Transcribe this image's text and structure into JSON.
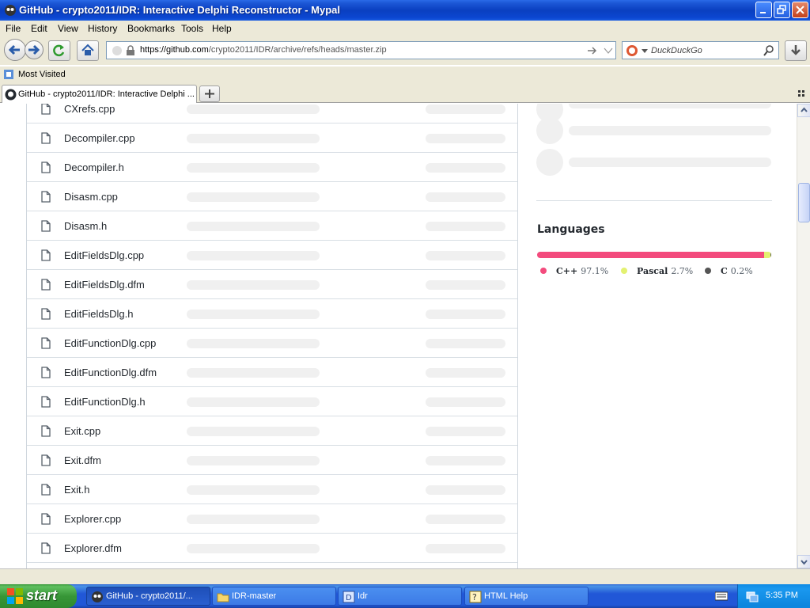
{
  "window": {
    "title": "GitHub - crypto2011/IDR: Interactive Delphi Reconstructor - Mypal"
  },
  "menu": [
    "File",
    "Edit",
    "View",
    "History",
    "Bookmarks",
    "Tools",
    "Help"
  ],
  "address": {
    "url_host": "https://github.com",
    "url_path": "/crypto2011/IDR/archive/refs/heads/master.zip"
  },
  "search": {
    "placeholder": "DuckDuckGo"
  },
  "bookmarks": {
    "most_visited": "Most Visited"
  },
  "tab": {
    "title": "GitHub - crypto2011/IDR: Interactive Delphi ..."
  },
  "files": [
    "CXrefs.cpp",
    "Decompiler.cpp",
    "Decompiler.h",
    "Disasm.cpp",
    "Disasm.h",
    "EditFieldsDlg.cpp",
    "EditFieldsDlg.dfm",
    "EditFieldsDlg.h",
    "EditFunctionDlg.cpp",
    "EditFunctionDlg.dfm",
    "EditFunctionDlg.h",
    "Exit.cpp",
    "Exit.dfm",
    "Exit.h",
    "Explorer.cpp",
    "Explorer.dfm"
  ],
  "languages": {
    "title": "Languages",
    "items": [
      {
        "name": "C++",
        "percent": "97.1%",
        "value": 97.1,
        "color": "#f34b7d"
      },
      {
        "name": "Pascal",
        "percent": "2.7%",
        "value": 2.7,
        "color": "#e3f171"
      },
      {
        "name": "C",
        "percent": "0.2%",
        "value": 0.2,
        "color": "#555555"
      }
    ]
  },
  "taskbar": {
    "start": "start",
    "tasks": [
      {
        "label": "GitHub - crypto2011/...",
        "icon": "browser-icon",
        "active": true
      },
      {
        "label": "IDR-master",
        "icon": "folder-icon",
        "active": false
      },
      {
        "label": "Idr",
        "icon": "app-icon",
        "active": false
      },
      {
        "label": "HTML Help",
        "icon": "help-icon",
        "active": false
      }
    ],
    "clock": "5:35 PM"
  }
}
